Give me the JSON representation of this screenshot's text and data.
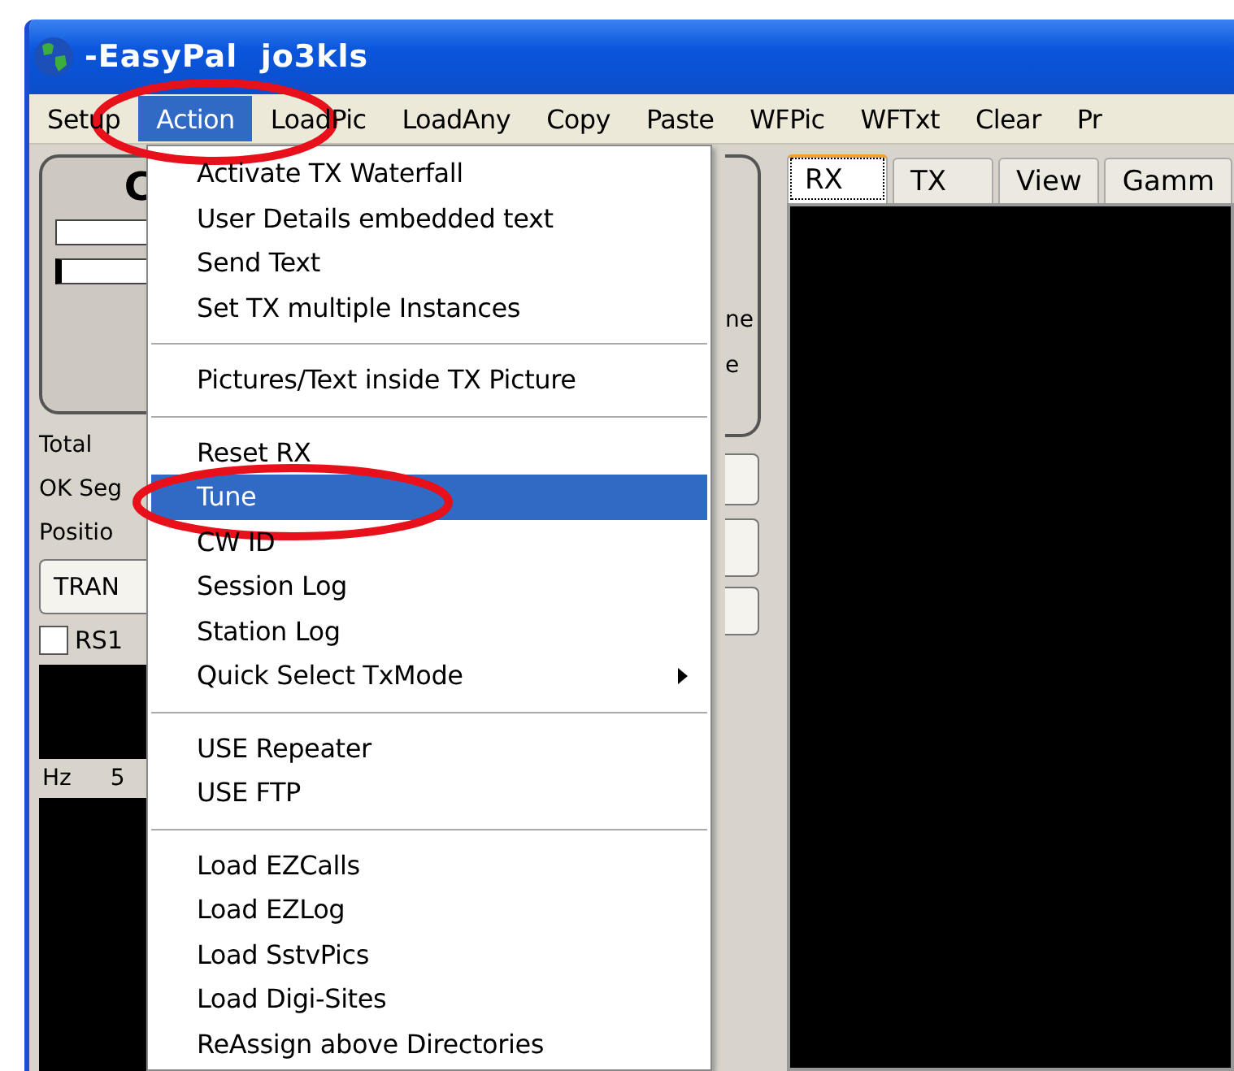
{
  "window": {
    "title": "-EasyPal  jo3kls"
  },
  "menu_bar": [
    {
      "label": "Setup",
      "selected": false
    },
    {
      "label": "Action",
      "selected": true
    },
    {
      "label": "LoadPic",
      "selected": false
    },
    {
      "label": "LoadAny",
      "selected": false
    },
    {
      "label": "Copy",
      "selected": false
    },
    {
      "label": "Paste",
      "selected": false
    },
    {
      "label": "WFPic",
      "selected": false
    },
    {
      "label": "WFTxt",
      "selected": false
    },
    {
      "label": "Clear",
      "selected": false
    },
    {
      "label": "Pr",
      "selected": false
    }
  ],
  "action_menu": {
    "groups": [
      [
        {
          "label": "Activate TX Waterfall",
          "kind": "item",
          "selected": false
        },
        {
          "label": "User Details embedded text",
          "kind": "item",
          "selected": false
        },
        {
          "label": "Send Text",
          "kind": "item",
          "selected": false
        },
        {
          "label": "Set TX multiple Instances",
          "kind": "item",
          "selected": false
        }
      ],
      [
        {
          "label": "Pictures/Text inside TX Picture",
          "kind": "item",
          "selected": false
        }
      ],
      [
        {
          "label": "Reset RX",
          "kind": "item",
          "selected": false
        },
        {
          "label": "Tune",
          "kind": "item",
          "selected": true
        },
        {
          "label": "CW ID",
          "kind": "item",
          "selected": false
        },
        {
          "label": "Session Log",
          "kind": "item",
          "selected": false
        },
        {
          "label": "Station Log",
          "kind": "item",
          "selected": false
        },
        {
          "label": "Quick Select TxMode",
          "kind": "submenu",
          "selected": false
        }
      ],
      [
        {
          "label": "USE Repeater",
          "kind": "item",
          "selected": false
        },
        {
          "label": "USE FTP",
          "kind": "item",
          "selected": false
        }
      ],
      [
        {
          "label": "Load EZCalls",
          "kind": "item",
          "selected": false
        },
        {
          "label": "Load EZLog",
          "kind": "item",
          "selected": false
        },
        {
          "label": "Load SstvPics",
          "kind": "item",
          "selected": false
        },
        {
          "label": "Load Digi-Sites",
          "kind": "item",
          "selected": false
        },
        {
          "label": "ReAssign above Directories",
          "kind": "item",
          "selected": false
        }
      ]
    ]
  },
  "left_panel": {
    "heading": "C",
    "labels": [
      "Total",
      "OK Seg",
      "Positio"
    ],
    "button": "TRAN",
    "checkbox": {
      "label": "RS1",
      "checked": false
    },
    "axis_labels": [
      "Hz",
      "5"
    ]
  },
  "middle_strip": {
    "texts": [
      "ne",
      "e"
    ]
  },
  "tabs": [
    {
      "label": "RX",
      "selected": true
    },
    {
      "label": "TX",
      "selected": false
    },
    {
      "label": "View",
      "selected": false
    },
    {
      "label": "Gamm",
      "selected": false
    }
  ]
}
